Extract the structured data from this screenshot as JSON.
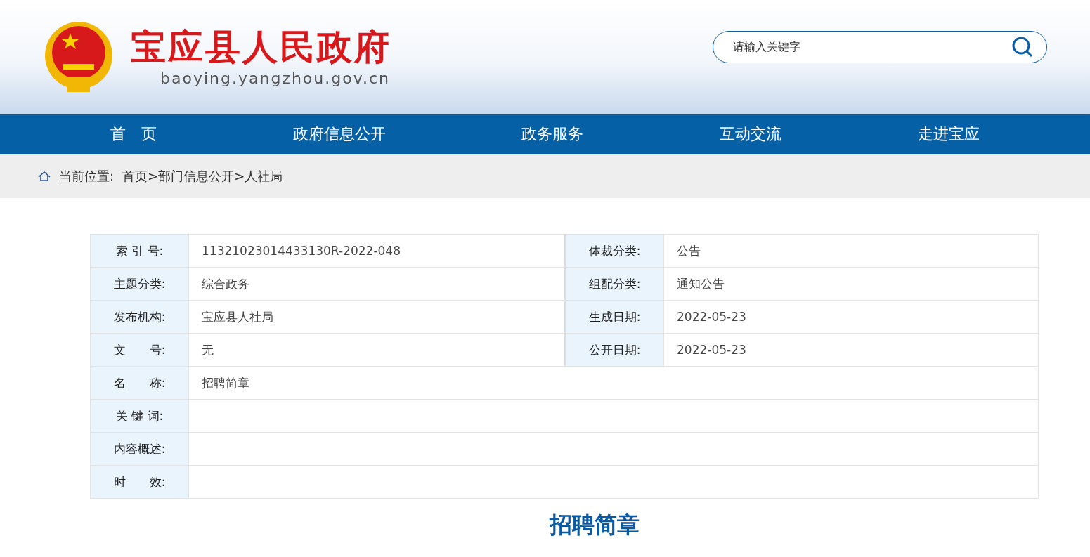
{
  "header": {
    "site_title": "宝应县人民政府",
    "domain": "baoying.yangzhou.gov.cn",
    "search": {
      "placeholder": "请输入关键字"
    }
  },
  "nav": {
    "items": [
      "首　页",
      "政府信息公开",
      "政务服务",
      "互动交流",
      "走进宝应"
    ]
  },
  "breadcrumb": {
    "label": "当前位置:",
    "path": "首页>部门信息公开>人社局"
  },
  "info_table": {
    "rows": [
      {
        "cells": [
          {
            "label": "索 引 号:",
            "value": "11321023014433130R-2022-048"
          },
          {
            "label": "体裁分类:",
            "value": "公告"
          }
        ]
      },
      {
        "cells": [
          {
            "label": "主题分类:",
            "value": "综合政务"
          },
          {
            "label": "组配分类:",
            "value": "通知公告"
          }
        ]
      },
      {
        "cells": [
          {
            "label": "发布机构:",
            "value": "宝应县人社局"
          },
          {
            "label": "生成日期:",
            "value": "2022-05-23"
          }
        ]
      },
      {
        "cells": [
          {
            "label": "文　　号:",
            "value": "无"
          },
          {
            "label": "公开日期:",
            "value": "2022-05-23"
          }
        ]
      },
      {
        "cells": [
          {
            "label": "名　　称:",
            "value": "招聘简章"
          }
        ]
      },
      {
        "cells": [
          {
            "label": "关 键 词:"
          }
        ]
      },
      {
        "cells": [
          {
            "label": "内容概述:"
          }
        ]
      },
      {
        "cells": [
          {
            "label": "时　　效:"
          }
        ]
      }
    ]
  },
  "article": {
    "title": "招聘简章"
  }
}
